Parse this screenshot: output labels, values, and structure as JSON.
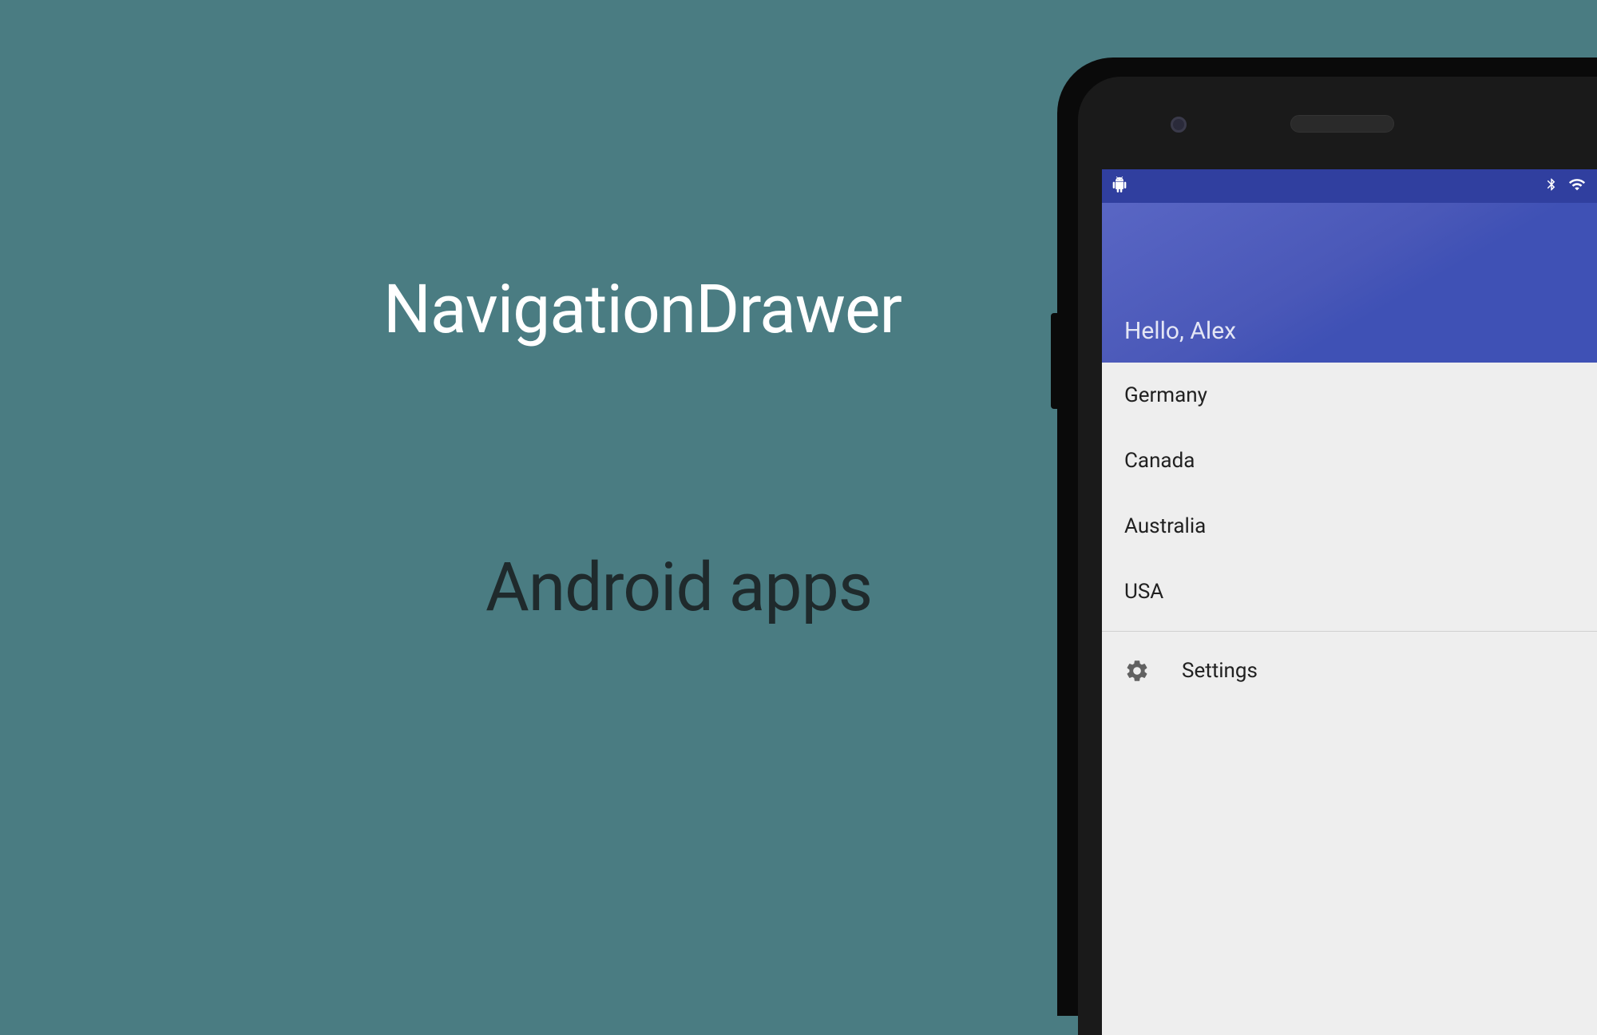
{
  "title": "NavigationDrawer",
  "subtitle": "Android apps",
  "statusbar": {
    "debug_icon": "android-debug-icon",
    "bluetooth_icon": "bluetooth-icon",
    "wifi_icon": "wifi-icon"
  },
  "drawer": {
    "greeting": "Hello, Alex",
    "items": [
      {
        "label": "Germany"
      },
      {
        "label": "Canada"
      },
      {
        "label": "Australia"
      },
      {
        "label": "USA"
      }
    ],
    "settings": {
      "label": "Settings",
      "icon": "gear-icon"
    }
  }
}
